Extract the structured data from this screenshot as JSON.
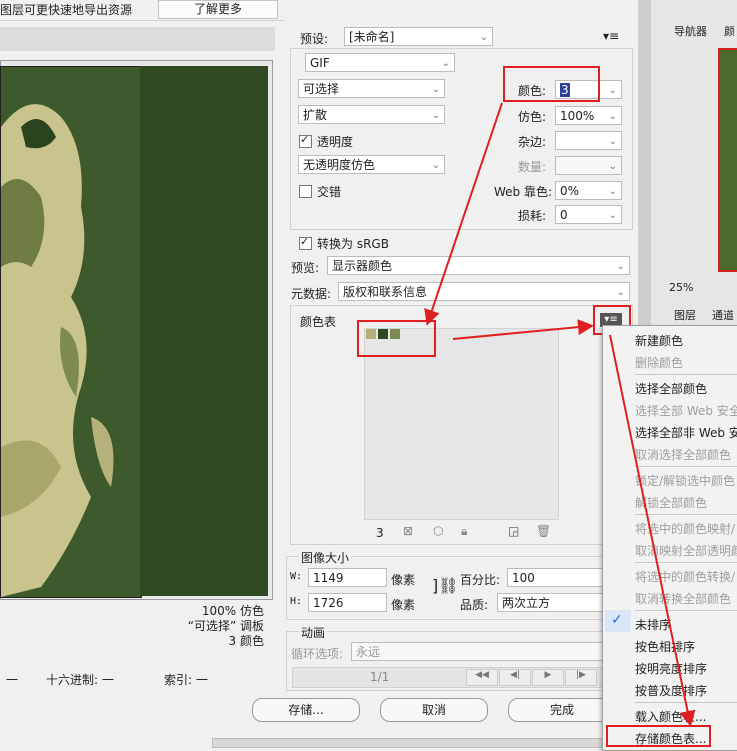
{
  "top": {
    "hint": "图层可更快速地导出资源",
    "learn_more": "了解更多"
  },
  "preview": {
    "info_lines": [
      "100% 仿色",
      "“可选择” 调板",
      "3 颜色"
    ],
    "status": {
      "hex_label": "十六进制: 一",
      "index_label": "索引: 一",
      "alpha_dash": "一"
    }
  },
  "settings": {
    "preset_label": "预设:",
    "preset_value": "[未命名]",
    "format": "GIF",
    "reduction": "可选择",
    "dither_algo": "扩散",
    "transparency_label": "透明度",
    "transparency_checked": true,
    "transparency_dither": "无透明度仿色",
    "interlaced_label": "交错",
    "interlaced_checked": false,
    "colors_label": "颜色:",
    "colors_value": "3",
    "dither_label": "仿色:",
    "dither_value": "100%",
    "matte_label": "杂边:",
    "amount_label": "数量:",
    "web_snap_label": "Web 靠色:",
    "web_snap_value": "0%",
    "lossy_label": "损耗:",
    "lossy_value": "0",
    "convert_srgb_label": "转换为 sRGB",
    "convert_srgb_checked": true,
    "preview_label": "预览:",
    "preview_value": "显示器颜色",
    "metadata_label": "元数据:",
    "metadata_value": "版权和联系信息"
  },
  "color_table": {
    "title": "颜色表",
    "count": "3",
    "swatches": [
      "#b5b07a",
      "#2e4a22",
      "#7c8a4e"
    ]
  },
  "image_size": {
    "title": "图像大小",
    "w_label": "W:",
    "w_value": "1149",
    "h_label": "H:",
    "h_value": "1726",
    "unit": "像素",
    "percent_label": "百分比:",
    "percent_value": "100",
    "quality_label": "品质:",
    "quality_value": "两次立方"
  },
  "animation": {
    "title": "动画",
    "loop_label": "循环选项:",
    "loop_value": "永远",
    "frame": "1/1"
  },
  "buttons": {
    "save": "存储...",
    "cancel": "取消",
    "done": "完成"
  },
  "menu": {
    "items": [
      {
        "label": "新建颜色",
        "enabled": true
      },
      {
        "label": "删除颜色",
        "enabled": false
      },
      {
        "label": "选择全部颜色",
        "enabled": true
      },
      {
        "label": "选择全部 Web 安全",
        "enabled": false
      },
      {
        "label": "选择全部非 Web 安",
        "enabled": true
      },
      {
        "label": "取消选择全部颜色",
        "enabled": false
      },
      {
        "label": "锁定/解锁选中颜色",
        "enabled": false
      },
      {
        "label": "解锁全部颜色",
        "enabled": false
      },
      {
        "label": "将选中的颜色映射/",
        "enabled": false
      },
      {
        "label": "取消映射全部透明颜",
        "enabled": false
      },
      {
        "label": "将选中的颜色转换/",
        "enabled": false
      },
      {
        "label": "取消转换全部颜色",
        "enabled": false
      },
      {
        "label": "未排序",
        "enabled": true
      },
      {
        "label": "按色相排序",
        "enabled": true
      },
      {
        "label": "按明亮度排序",
        "enabled": true
      },
      {
        "label": "按普及度排序",
        "enabled": true
      },
      {
        "label": "载入颜色表...",
        "enabled": true
      },
      {
        "label": "存储颜色表...",
        "enabled": true
      }
    ]
  },
  "side": {
    "navigator_tab": "导航器",
    "color_tab": "颜",
    "zoom": "25%",
    "layers_tab": "图层",
    "channels_tab": "通道"
  },
  "colors": {
    "accent_red": "#e02020",
    "check_blue": "#1e6fd9"
  }
}
